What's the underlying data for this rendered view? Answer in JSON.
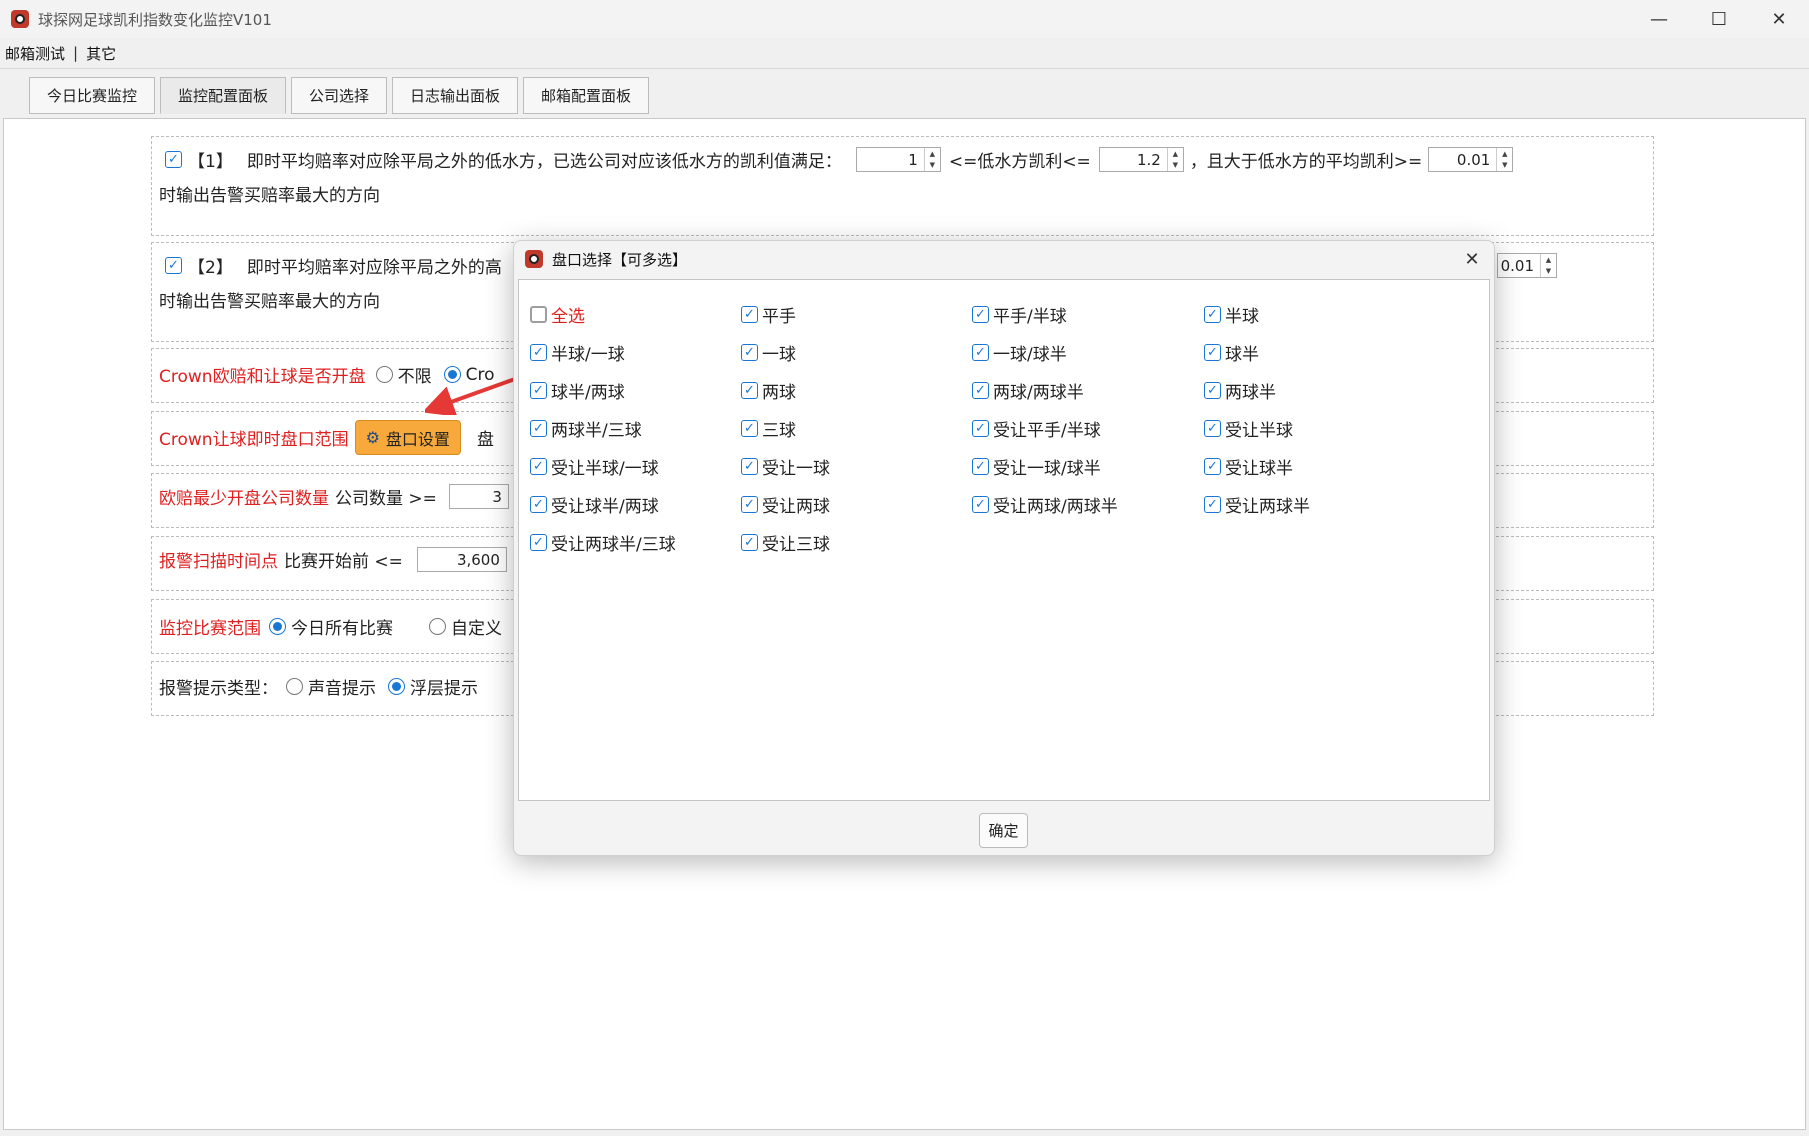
{
  "window": {
    "title": "球探网足球凯利指数变化监控V101",
    "controls": [
      "—",
      "☐",
      "✕"
    ]
  },
  "menu": {
    "items": [
      "邮箱测试",
      "其它"
    ],
    "separator": "|"
  },
  "tabs": [
    {
      "label": "今日比赛监控"
    },
    {
      "label": "监控配置面板"
    },
    {
      "label": "公司选择"
    },
    {
      "label": "日志输出面板"
    },
    {
      "label": "邮箱配置面板"
    }
  ],
  "rule1": {
    "number": "【1】",
    "text": "即时平均赔率对应除平局之外的低水方，已选公司对应该低水方的凯利值满足：",
    "min_value": "1",
    "mid_label": "<=低水方凯利<=",
    "max_value": "1.2",
    "tail_label": "，且大于低水方的平均凯利>=",
    "avg_value": "0.01",
    "line2": "时输出告警买赔率最大的方向"
  },
  "rule2": {
    "number": "【2】",
    "text": "即时平均赔率对应除平局之外的高",
    "avg_value": "0.01",
    "line2": "时输出告警买赔率最大的方向"
  },
  "crown_open": {
    "label": "Crown欧赔和让球是否开盘",
    "opt_unlimited": "不限",
    "opt_crown": "Cro"
  },
  "crown_range": {
    "label": "Crown让球即时盘口范围",
    "button": "盘口设置",
    "after": "盘"
  },
  "min_companies": {
    "label": "欧赔最少开盘公司数量",
    "sub": "公司数量 >=",
    "value": "3"
  },
  "scan_time": {
    "label": "报警扫描时间点",
    "sub": "比赛开始前 <=",
    "value": "3,600"
  },
  "match_scope": {
    "label": "监控比赛范围",
    "opt_all": "今日所有比赛",
    "opt_custom": "自定义"
  },
  "alert_type": {
    "label": "报警提示类型：",
    "opt_sound": "声音提示",
    "opt_float": "浮层提示"
  },
  "dialog": {
    "title": "盘口选择【可多选】",
    "ok": "确定",
    "options": [
      {
        "label": "全选",
        "checked": false,
        "red": true
      },
      {
        "label": "平手",
        "checked": true
      },
      {
        "label": "平手/半球",
        "checked": true
      },
      {
        "label": "半球",
        "checked": true
      },
      {
        "label": "半球/一球",
        "checked": true
      },
      {
        "label": "一球",
        "checked": true
      },
      {
        "label": "一球/球半",
        "checked": true
      },
      {
        "label": "球半",
        "checked": true
      },
      {
        "label": "球半/两球",
        "checked": true
      },
      {
        "label": "两球",
        "checked": true
      },
      {
        "label": "两球/两球半",
        "checked": true
      },
      {
        "label": "两球半",
        "checked": true
      },
      {
        "label": "两球半/三球",
        "checked": true
      },
      {
        "label": "三球",
        "checked": true
      },
      {
        "label": "受让平手/半球",
        "checked": true
      },
      {
        "label": "受让半球",
        "checked": true
      },
      {
        "label": "受让半球/一球",
        "checked": true
      },
      {
        "label": "受让一球",
        "checked": true
      },
      {
        "label": "受让一球/球半",
        "checked": true
      },
      {
        "label": "受让球半",
        "checked": true
      },
      {
        "label": "受让球半/两球",
        "checked": true
      },
      {
        "label": "受让两球",
        "checked": true
      },
      {
        "label": "受让两球/两球半",
        "checked": true
      },
      {
        "label": "受让两球半",
        "checked": true
      },
      {
        "label": "受让两球半/三球",
        "checked": true
      },
      {
        "label": "受让三球",
        "checked": true
      }
    ]
  },
  "icons": {
    "app": "app-logo-icon",
    "check": "✓",
    "gear": "⚙",
    "spin_up": "▲",
    "spin_down": "▼"
  },
  "colors": {
    "accent": "#1976d2",
    "label_red": "#e02020",
    "button_orange": "#f7a93b",
    "annotation_arrow": "#e53935"
  }
}
